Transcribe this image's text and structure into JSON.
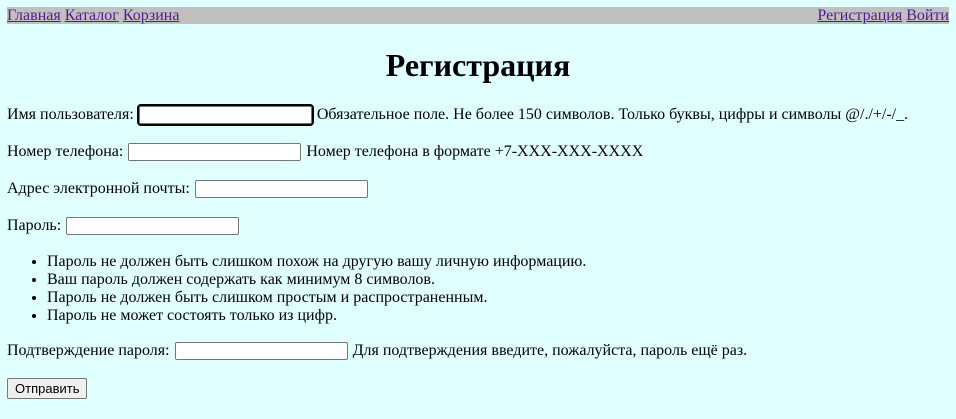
{
  "nav": {
    "home": "Главная",
    "catalog": "Каталог",
    "cart": "Корзина",
    "register": "Регистрация",
    "login": "Войти"
  },
  "page_title": "Регистрация",
  "form": {
    "username": {
      "label": "Имя пользователя:",
      "value": "",
      "help": "Обязательное поле. Не более 150 символов. Только буквы, цифры и символы @/./+/-/_."
    },
    "phone": {
      "label": "Номер телефона:",
      "value": "",
      "help": "Номер телефона в формате +7-XXX-XXX-XXXX"
    },
    "email": {
      "label": "Адрес электронной почты:",
      "value": ""
    },
    "password": {
      "label": "Пароль:",
      "value": "",
      "rules": [
        "Пароль не должен быть слишком похож на другую вашу личную информацию.",
        "Ваш пароль должен содержать как минимум 8 символов.",
        "Пароль не должен быть слишком простым и распространенным.",
        "Пароль не может состоять только из цифр."
      ]
    },
    "password_confirm": {
      "label": "Подтверждение пароля:",
      "value": "",
      "help": "Для подтверждения введите, пожалуйста, пароль ещё раз."
    },
    "submit_label": "Отправить"
  }
}
